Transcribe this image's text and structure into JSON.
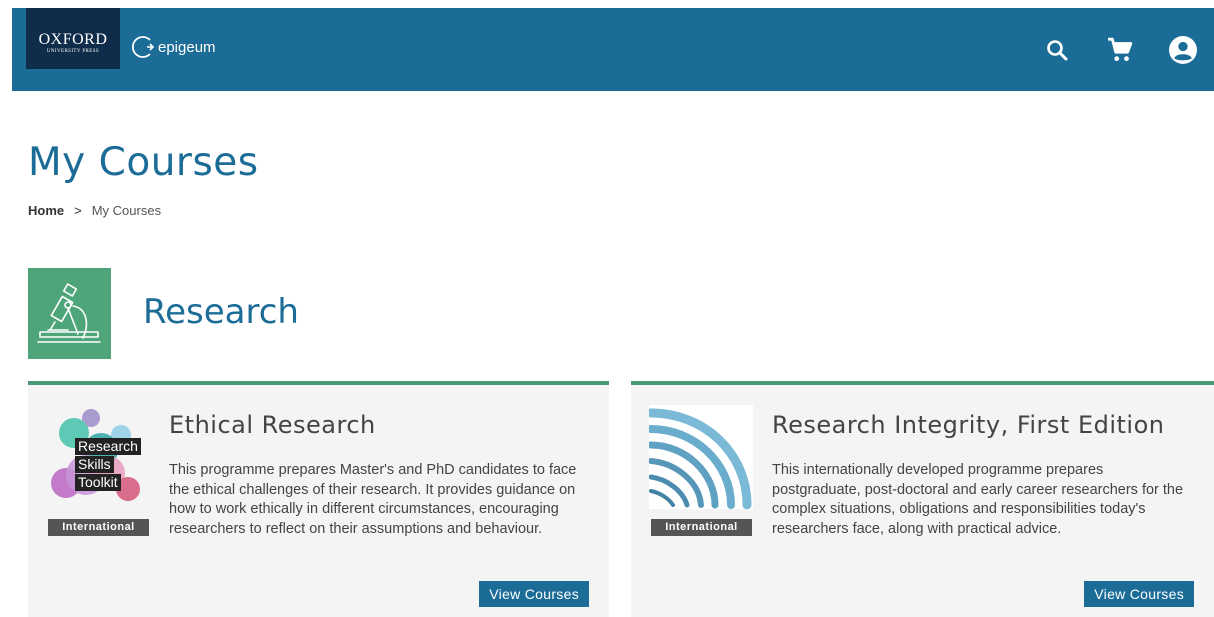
{
  "header": {
    "oup_logo_top": "OXFORD",
    "oup_logo_bottom": "UNIVERSITY PRESS",
    "brand": "epigeum",
    "icons": [
      "search-icon",
      "cart-icon",
      "account-icon"
    ],
    "bar_color": "#1c6c98"
  },
  "page": {
    "title": "My Courses",
    "breadcrumb": {
      "home": "Home",
      "separator": ">",
      "current": "My Courses"
    }
  },
  "category": {
    "title": "Research",
    "icon": "microscope-icon",
    "color": "#4fa57a"
  },
  "courses": [
    {
      "title": "Ethical Research",
      "thumb_lines": [
        "Research",
        "Skills",
        "Toolkit"
      ],
      "tag": "International",
      "description": "This programme prepares Master's and PhD candidates to face the ethical challenges of their research. It provides guidance on how to work ethically in different circumstances, encouraging researchers to reflect on their assumptions and behaviour.",
      "button": "View Courses"
    },
    {
      "title": "Research Integrity, First Edition",
      "tag": "International",
      "description": "This internationally developed programme prepares postgraduate, post-doctoral and early career researchers for the complex situations, obligations and responsibilities today's researchers face, along with practical advice.",
      "button": "View Courses"
    }
  ]
}
